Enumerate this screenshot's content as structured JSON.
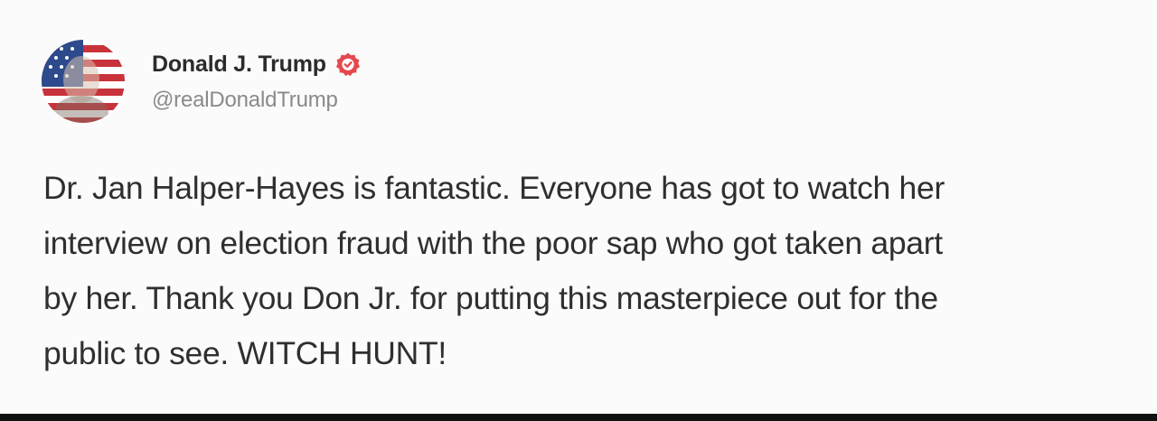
{
  "post": {
    "display_name": "Donald J. Trump",
    "handle": "@realDonaldTrump",
    "verified": true,
    "avatar_icon": "flag-portrait-avatar",
    "verified_icon": "verified-badge-icon",
    "body_lines": [
      "Dr. Jan Halper-Hayes is fantastic. Everyone has got to watch her",
      "interview on election fraud with the poor sap who got taken apart",
      "by her. Thank you Don Jr. for putting this masterpiece out for the",
      "public to see. WITCH HUNT!"
    ]
  },
  "colors": {
    "verified_badge": "#e5484d",
    "flag_red": "#c8323a",
    "flag_blue": "#2d4a8c",
    "bottom_bar": "#111111"
  }
}
